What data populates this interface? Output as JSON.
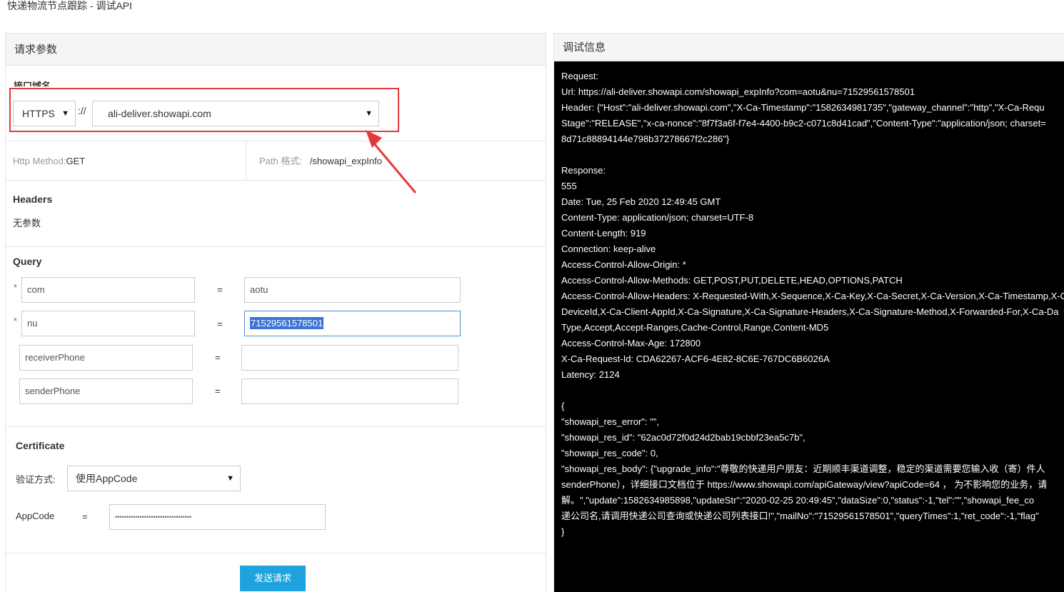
{
  "window": {
    "title": "快递物流节点跟踪 - 调试API"
  },
  "left": {
    "header": "请求参数",
    "domain": {
      "label": "接口域名",
      "protocol": "HTTPS",
      "separator": "://",
      "host": "ali-deliver.showapi.com"
    },
    "method": {
      "label": "Http Method:",
      "value": "GET",
      "path_label": "Path 格式:",
      "path_value": "/showapi_expInfo"
    },
    "headers": {
      "title": "Headers",
      "empty_text": "无参数"
    },
    "query": {
      "title": "Query",
      "rows": [
        {
          "required": true,
          "name": "com",
          "eq": "=",
          "value": "aotu"
        },
        {
          "required": true,
          "name": "nu",
          "eq": "=",
          "value": "71529561578501"
        },
        {
          "required": false,
          "name": "receiverPhone",
          "eq": "=",
          "value": ""
        },
        {
          "required": false,
          "name": "senderPhone",
          "eq": "=",
          "value": ""
        }
      ],
      "required_mark": "*"
    },
    "certificate": {
      "title": "Certificate",
      "auth_label": "验证方式:",
      "auth_value": "使用AppCode",
      "appcode_label": "AppCode",
      "appcode_eq": "=",
      "appcode_value": "••••••••••••••••••••••••••••••••••"
    },
    "submit": "发送请求"
  },
  "right": {
    "header": "调试信息",
    "lines": [
      "Request:",
      "Url: https://ali-deliver.showapi.com/showapi_expInfo?com=aotu&nu=71529561578501",
      "Header: {\"Host\":\"ali-deliver.showapi.com\",\"X-Ca-Timestamp\":\"1582634981735\",\"gateway_channel\":\"http\",\"X-Ca-Requ",
      "Stage\":\"RELEASE\",\"x-ca-nonce\":\"8f7f3a6f-f7e4-4400-b9c2-c071c8d41cad\",\"Content-Type\":\"application/json; charset=",
      "8d71c88894144e798b37278667f2c286\"}",
      "",
      "Response:",
      "555",
      "Date: Tue, 25 Feb 2020 12:49:45 GMT",
      "Content-Type: application/json; charset=UTF-8",
      "Content-Length: 919",
      "Connection: keep-alive",
      "Access-Control-Allow-Origin: *",
      "Access-Control-Allow-Methods: GET,POST,PUT,DELETE,HEAD,OPTIONS,PATCH",
      "Access-Control-Allow-Headers: X-Requested-With,X-Sequence,X-Ca-Key,X-Ca-Secret,X-Ca-Version,X-Ca-Timestamp,X-C",
      "DeviceId,X-Ca-Client-AppId,X-Ca-Signature,X-Ca-Signature-Headers,X-Ca-Signature-Method,X-Forwarded-For,X-Ca-Da",
      "Type,Accept,Accept-Ranges,Cache-Control,Range,Content-MD5",
      "Access-Control-Max-Age: 172800",
      "X-Ca-Request-Id: CDA62267-ACF6-4E82-8C6E-767DC6B6026A",
      "Latency: 2124",
      "",
      "{",
      "\"showapi_res_error\": \"\",",
      "\"showapi_res_id\": \"62ac0d72f0d24d2bab19cbbf23ea5c7b\",",
      "\"showapi_res_code\": 0,",
      "\"showapi_res_body\": {\"upgrade_info\":\"尊敬的快递用户朋友：近期顺丰渠道调整，稳定的渠道需要您输入收（寄）件人",
      "senderPhone），详细接口文档位于 https://www.showapi.com/apiGateway/view?apiCode=64 ， 为不影响您的业务，请",
      "解。\",\"update\":1582634985898,\"updateStr\":\"2020-02-25 20:49:45\",\"dataSize\":0,\"status\":-1,\"tel\":\"\",\"showapi_fee_co",
      "递公司名,请调用快递公司查询或快递公司列表接口!\",\"mailNo\":\"71529561578501\",\"queryTimes\":1,\"ret_code\":-1,\"flag\"",
      "}"
    ]
  }
}
